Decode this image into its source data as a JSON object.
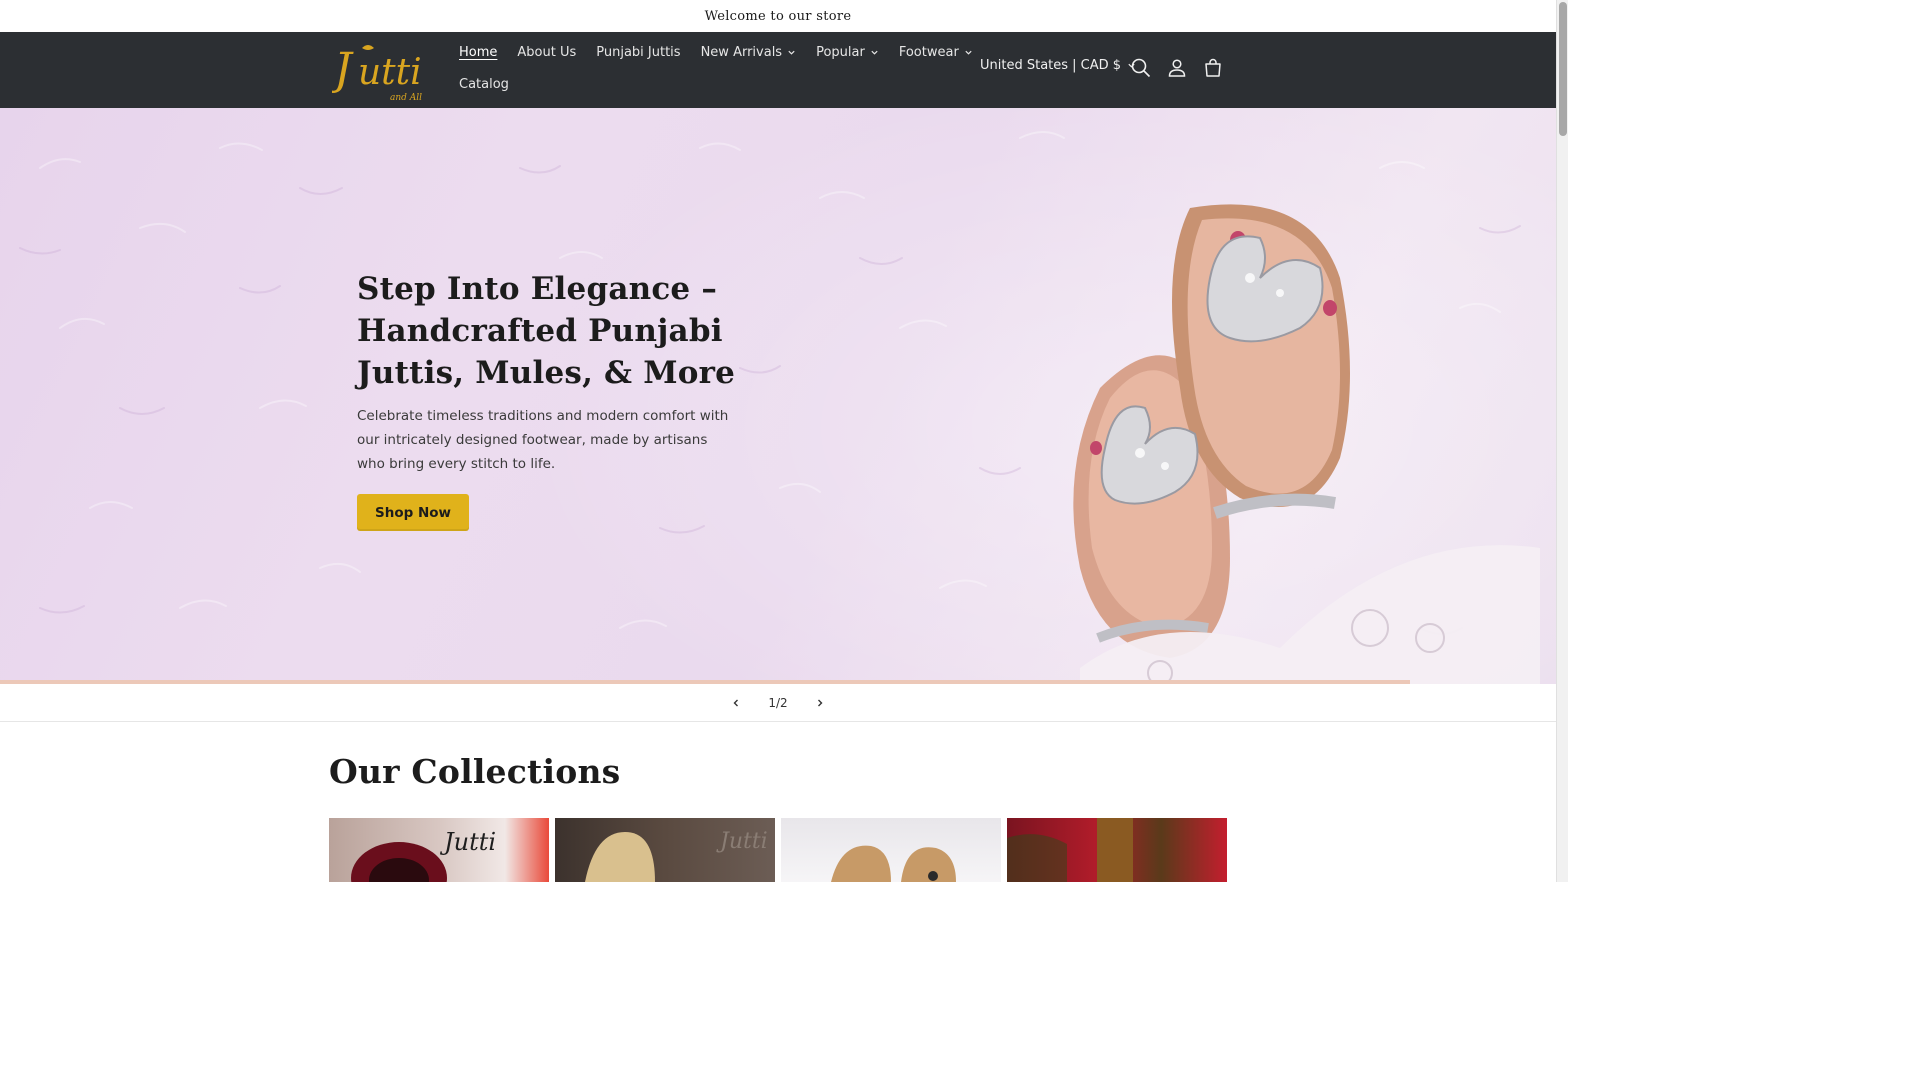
{
  "announcement": {
    "text": "Welcome to our store"
  },
  "header": {
    "logo_text": "Jutti",
    "logo_subtext": "and All",
    "nav": [
      {
        "label": "Home",
        "active": true,
        "has_dropdown": false
      },
      {
        "label": "About Us",
        "active": false,
        "has_dropdown": false
      },
      {
        "label": "Punjabi Juttis",
        "active": false,
        "has_dropdown": false
      },
      {
        "label": "New Arrivals",
        "active": false,
        "has_dropdown": true
      },
      {
        "label": "Popular",
        "active": false,
        "has_dropdown": true
      },
      {
        "label": "Footwear",
        "active": false,
        "has_dropdown": true
      },
      {
        "label": "Catalog",
        "active": false,
        "has_dropdown": false
      }
    ],
    "locale": "United States | CAD $",
    "icons": [
      "search-icon",
      "account-icon",
      "cart-icon"
    ]
  },
  "hero": {
    "title": "Step Into Elegance – Handcrafted Punjabi Juttis, Mules, & More",
    "subtitle": "Celebrate timeless traditions and modern comfort with our intricately designed footwear, made by artisans who bring every stitch to life.",
    "button_label": "Shop Now"
  },
  "slider": {
    "counter": "1/2",
    "progress": 0.906
  },
  "collections": {
    "title": "Our Collections",
    "cards": [
      "collection-card-1",
      "collection-card-2",
      "collection-card-3",
      "collection-card-4"
    ]
  },
  "colors": {
    "header_bg": "#2c2f33",
    "accent_button": "#e0b21b",
    "logo_gold": "#d9a520",
    "hero_bg": "#e9d8ed"
  }
}
